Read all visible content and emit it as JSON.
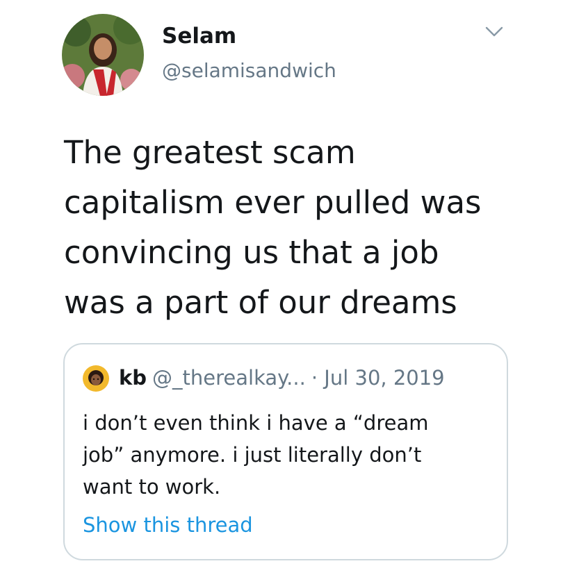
{
  "author": {
    "display_name": "Selam",
    "handle": "@selamisandwich",
    "avatar_icon": "profile-photo"
  },
  "menu": {
    "icon": "chevron-down-icon"
  },
  "tweet": {
    "lines": [
      "The greatest scam",
      "capitalism ever pulled was",
      "convincing us that a job",
      "was a part of our dreams"
    ]
  },
  "quoted_tweet": {
    "avatar_icon": "profile-photo",
    "display_name": "kb",
    "handle": "@_therealkay...",
    "date": "· Jul 30, 2019",
    "lines": [
      "i don’t even think i have a “dream",
      "job” anymore. i just literally don’t",
      "want to work."
    ],
    "show_thread_label": "Show this thread"
  },
  "colors": {
    "text": "#14171a",
    "secondary": "#657786",
    "link": "#1b95e0",
    "border": "#cfd9de"
  }
}
